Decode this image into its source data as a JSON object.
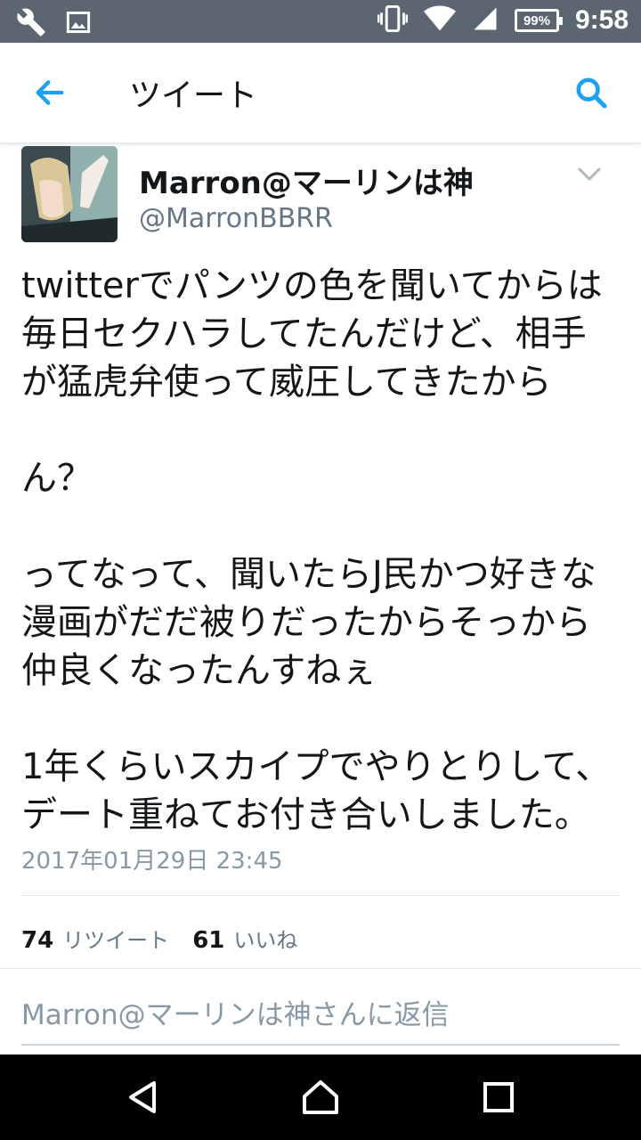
{
  "status_bar": {
    "time": "9:58",
    "battery": "99%",
    "icons": [
      "wrench-icon",
      "image-icon",
      "vibrate-icon",
      "wifi-icon",
      "signal-icon",
      "battery-icon"
    ]
  },
  "app_bar": {
    "title": "ツイート",
    "icons": [
      "back-arrow-icon",
      "search-icon"
    ]
  },
  "tweet": {
    "author_name": "Marron@マーリンは神",
    "author_handle": "@MarronBBRR",
    "text": "twitterでパンツの色を聞いてからは\n毎日セクハラしてたんだけど、相手\nが猛虎弁使って威圧してきたから\n\nん？\n\nってなって、聞いたらJ民かつ好きな\n漫画がだだ被りだったからそっから\n仲良くなったんすねぇ\n\n1年くらいスカイプでやりとりして、\nデート重ねてお付き合いしました。",
    "timestamp": "2017年01月29日 23:45",
    "retweet_count": "74",
    "retweet_label": "リツイート",
    "like_count": "61",
    "like_label": "いいね"
  },
  "reply": {
    "placeholder": "Marron@マーリンは神さんに返信"
  },
  "nav_bar": {
    "icons": [
      "back-triangle-icon",
      "home-icon",
      "recents-icon"
    ]
  },
  "colors": {
    "accent": "#1da1f2",
    "status_bar": "#5b6670",
    "text": "#14171a",
    "secondary_text": "#657786"
  }
}
